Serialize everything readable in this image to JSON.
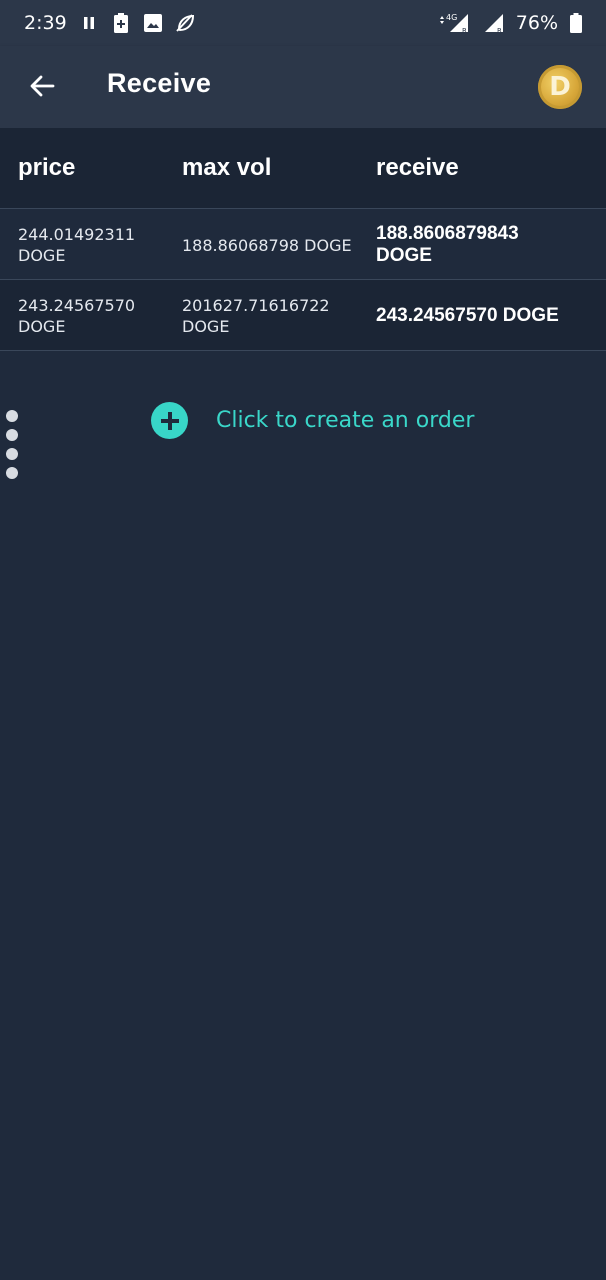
{
  "status_bar": {
    "time": "2:39",
    "network": "4G",
    "battery": "76%",
    "icons": [
      "pause-icon",
      "battery-saver-icon",
      "image-icon",
      "no-leaf-icon",
      "signal-icon",
      "battery-icon"
    ]
  },
  "app_bar": {
    "title": "Receive",
    "coin_symbol": "D"
  },
  "table": {
    "headers": {
      "price": "price",
      "max_vol": "max vol",
      "receive": "receive"
    },
    "rows": [
      {
        "price_value": "244.01492311",
        "price_unit": "DOGE",
        "vol_value": "188.86068798 DOGE",
        "receive_value": "188.8606879843",
        "receive_unit": "DOGE"
      },
      {
        "price_value": "243.24567570",
        "price_unit": "DOGE",
        "vol_value": "201627.71616722",
        "vol_unit": "DOGE",
        "receive_value": "243.24567570 DOGE"
      }
    ]
  },
  "create_order": {
    "label": "Click to create an order"
  },
  "colors": {
    "background": "#1f2a3c",
    "app_bar": "#2c3749",
    "accent": "#38d6c8"
  }
}
